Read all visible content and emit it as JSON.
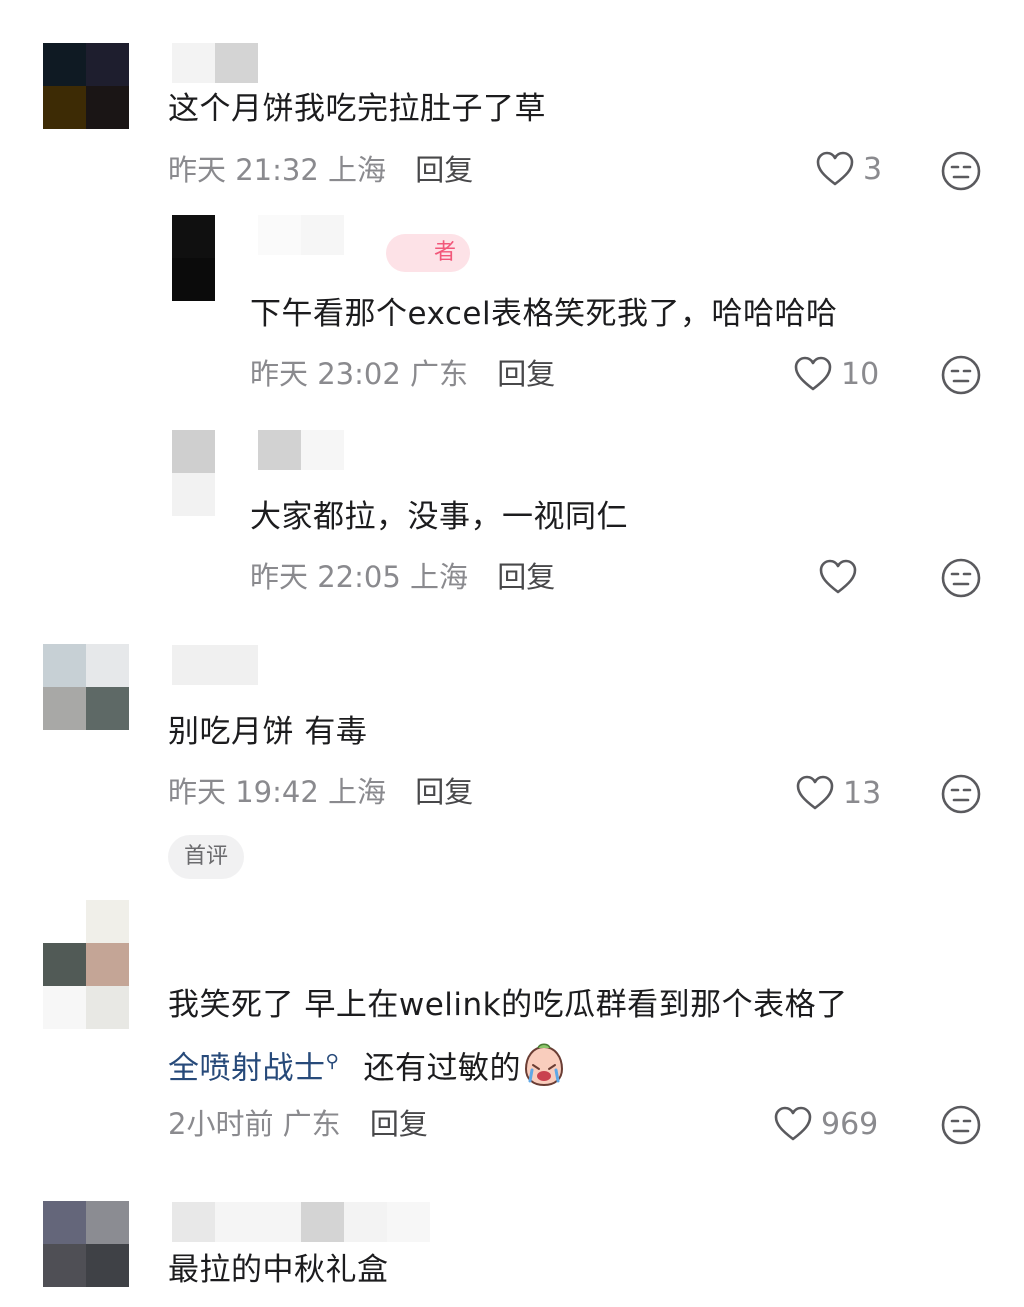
{
  "comments": [
    {
      "text": "这个月饼我吃完拉肚子了草",
      "time": "昨天 21:32",
      "location": "上海",
      "reply_label": "回复",
      "likes": "3",
      "colors": {
        "avatar": [
          "#0f1a23",
          "#1e1e2e",
          "#3d2b05",
          "#1a1515"
        ]
      }
    },
    {
      "text": "下午看那个excel表格笑死我了，哈哈哈哈",
      "author_tag": "者",
      "time": "昨天 23:02",
      "location": "广东",
      "reply_label": "回复",
      "likes": "10"
    },
    {
      "text": "大家都拉，没事，一视同仁",
      "time": "昨天 22:05",
      "location": "上海",
      "reply_label": "回复",
      "likes": ""
    },
    {
      "text": "别吃月饼 有毒",
      "time": "昨天 19:42",
      "location": "上海",
      "reply_label": "回复",
      "likes": "13",
      "badge": "首评"
    },
    {
      "text": "我笑死了 早上在welink的吃瓜群看到那个表格了",
      "text_line2_link": "全喷射战士",
      "text_line2_rest": "还有过敏的",
      "time": "2小时前",
      "location": "广东",
      "reply_label": "回复",
      "likes": "969"
    },
    {
      "text": "最拉的中秋礼盒"
    }
  ],
  "icons": {
    "like": "heart-outline-icon",
    "dislike": "neutral-face-icon",
    "search": "search-icon",
    "emoji": "crying-emoji-icon"
  },
  "theme": {
    "text": "#1c1c1e",
    "meta": "#8a8a8e",
    "link": "#274a7a",
    "author_tag_bg": "#fde2e7",
    "author_tag_fg": "#f2577a"
  }
}
